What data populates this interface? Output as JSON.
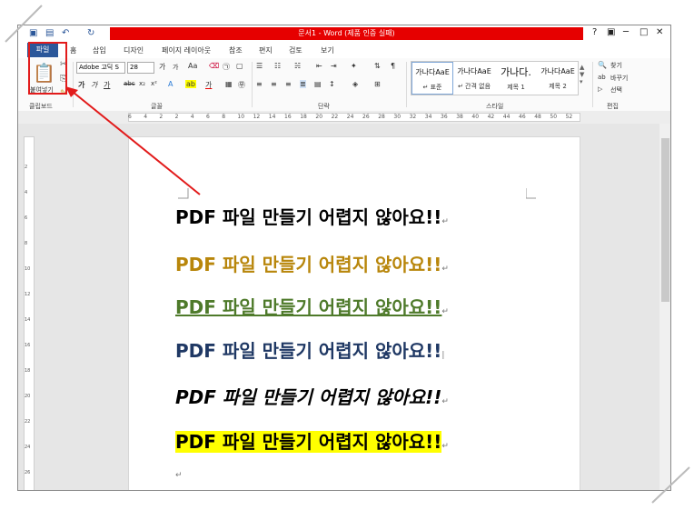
{
  "window": {
    "title": "문서1 - Word (제품 인증 실패)",
    "help": "?",
    "controls": [
      "▣",
      "─",
      "□",
      "✕"
    ]
  },
  "tabs": {
    "file": "파일",
    "home": "홈",
    "items": [
      "삽입",
      "디자인",
      "페이지 레이아웃",
      "참조",
      "편지",
      "검토",
      "보기"
    ]
  },
  "ribbon": {
    "clipboard": {
      "paste_label": "붙여넣기",
      "group_label": "클립보드"
    },
    "font": {
      "font_name": "Adobe 고딕 S",
      "font_size": "28",
      "group_label": "글꼴",
      "grow": "가",
      "shrink": "가",
      "case": "Aa",
      "bold": "가",
      "italic": "가",
      "underline": "가"
    },
    "paragraph": {
      "group_label": "단락"
    },
    "styles": {
      "group_label": "스타일",
      "items": [
        {
          "preview": "가나다AaE",
          "label": "↵ 표준"
        },
        {
          "preview": "가나다AaE",
          "label": "↵ 간격 없음"
        },
        {
          "preview": "가나다.",
          "label": "제목 1"
        },
        {
          "preview": "가나다AaE",
          "label": "제목 2"
        }
      ]
    },
    "editing": {
      "group_label": "편집",
      "find": "찾기",
      "replace": "바꾸기",
      "select": "선택"
    }
  },
  "ruler": {
    "ticks": [
      "6",
      "4",
      "2",
      "2",
      "4",
      "6",
      "8",
      "10",
      "12",
      "14",
      "16",
      "18",
      "20",
      "22",
      "24",
      "26",
      "28",
      "30",
      "32",
      "34",
      "36",
      "38",
      "40",
      "42",
      "44",
      "46",
      "48",
      "50",
      "52"
    ]
  },
  "vertical_ruler": {
    "ticks": [
      "2",
      "4",
      "6",
      "8",
      "10",
      "12",
      "14",
      "16",
      "18",
      "20",
      "22",
      "24",
      "26"
    ]
  },
  "document": {
    "lines": [
      {
        "text": "PDF 파일 만들기 어렵지 않아요!!",
        "color": "#000000",
        "style": "plain"
      },
      {
        "text": "PDF 파일 만들기 어렵지 않아요!!",
        "color": "#b8860b",
        "style": "plain"
      },
      {
        "text": "PDF 파일 만들기 어렵지 않아요!!",
        "color": "#4e7a2a",
        "style": "underline"
      },
      {
        "text": "PDF 파일 만들기 어렵지 않아요!!",
        "color": "#1f3864",
        "style": "plain"
      },
      {
        "text": "PDF 파일 만들기 어렵지 않아요!!",
        "color": "#000000",
        "style": "italic"
      },
      {
        "text": "PDF 파일 만들기 어렵지 않아요!!",
        "color": "#000000",
        "style": "highlight"
      }
    ],
    "highlight_color": "#ffff00",
    "annotation_color": "#e21b1b"
  }
}
